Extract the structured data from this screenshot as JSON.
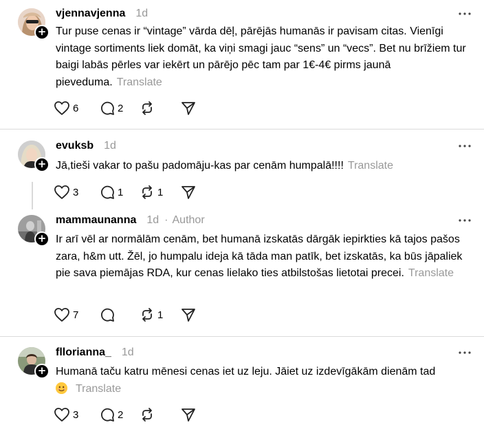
{
  "comments": [
    {
      "username": "vjennavjenna",
      "time": "1d",
      "text": "Tur puse cenas ir “vintage” vārda dēļ, pārējās humanās ir pavisam citas. Vienīgi vintage sortiments liek domāt, ka viņi smagi jauc “sens” un “vecs”. Bet nu brīžiem tur baigi labās pērles var iekērt un pārējo pēc tam par 1€-4€ pirms jaunā pieveduma.",
      "translate": "Translate",
      "likes": "6",
      "replies": "2",
      "reposts": ""
    },
    {
      "username": "evuksb",
      "time": "1d",
      "text": "Jā,tieši vakar to pašu padomāju-kas par cenām humpalā!!!!",
      "translate": "Translate",
      "likes": "3",
      "replies": "1",
      "reposts": "1"
    },
    {
      "username": "mammaunanna",
      "time": "1d",
      "author_label": "Author",
      "text": "Ir arī vēl ar normālām cenām, bet humanā izskatās dārgāk iepirkties kā tajos pašos zara, h&m utt. Žēl, jo humpalu ideja kā tāda man patīk, bet izskatās, ka būs jāpaliek pie sava piemājas RDA, kur cenas lielako ties atbilstošas lietotai precei.",
      "translate": "Translate",
      "likes": "7",
      "replies": "",
      "reposts": "1"
    },
    {
      "username": "fllorianna_",
      "time": "1d",
      "text": "Humanā taču katru mēnesi cenas iet uz leju. Jāiet uz izdevīgākām dienām tad",
      "translate": "Translate",
      "likes": "3",
      "replies": "2",
      "reposts": ""
    }
  ],
  "icons": {
    "like": "heart-icon",
    "reply": "comment-icon",
    "repost": "repost-icon",
    "share": "send-icon",
    "more": "more-icon",
    "follow": "plus-icon"
  },
  "colors": {
    "muted": "#999999",
    "divider": "#dbdbdb"
  }
}
